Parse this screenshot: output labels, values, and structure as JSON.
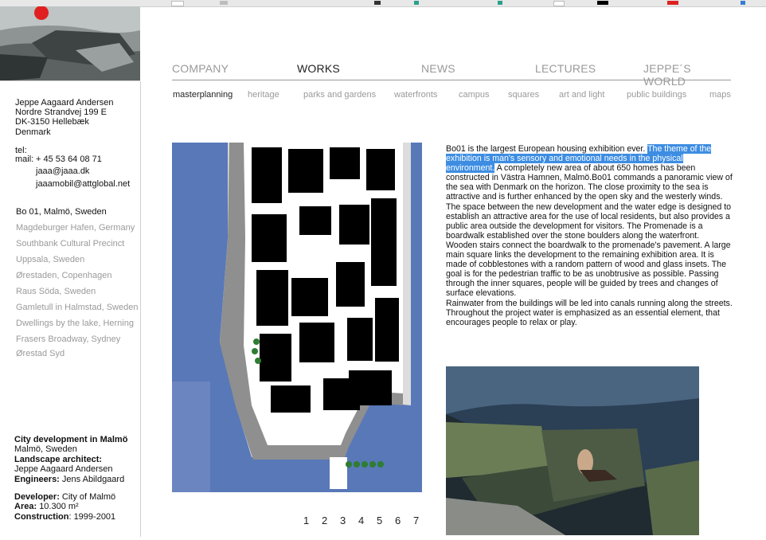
{
  "nav": {
    "main": [
      {
        "label": "COMPANY",
        "active": false
      },
      {
        "label": "WORKS",
        "active": true
      },
      {
        "label": "NEWS",
        "active": false
      },
      {
        "label": "LECTURES",
        "active": false
      },
      {
        "label": "JEPPE´S WORLD",
        "active": false
      }
    ],
    "sub": [
      {
        "label": "masterplanning",
        "active": true
      },
      {
        "label": "heritage",
        "active": false
      },
      {
        "label": "parks and gardens",
        "active": false
      },
      {
        "label": "waterfronts",
        "active": false
      },
      {
        "label": "campus",
        "active": false
      },
      {
        "label": "squares",
        "active": false
      },
      {
        "label": "art and light",
        "active": false
      },
      {
        "label": "public buildings",
        "active": false
      },
      {
        "label": "maps",
        "active": false
      }
    ]
  },
  "contact": {
    "name": "Jeppe Aagaard Andersen",
    "street": "Nordre Strandvej 199 E",
    "city": "DK-3150 Hellebæk",
    "country": "Denmark",
    "tel_label": "tel:",
    "mail_label": "mail:",
    "tel": "+ 45 53 64 08 71",
    "email1": "jaaa@jaaa.dk",
    "email2": "jaaamobil@attglobal.net"
  },
  "projects": [
    {
      "label": "Bo 01, Malmö, Sweden",
      "active": true
    },
    {
      "label": "Magdeburger Hafen, Germany",
      "active": false
    },
    {
      "label": "Southbank Cultural Precinct",
      "active": false
    },
    {
      "label": "Uppsala, Sweden",
      "active": false
    },
    {
      "label": "Ørestaden, Copenhagen",
      "active": false
    },
    {
      "label": "Raus Söda, Sweden",
      "active": false
    },
    {
      "label": "Gamletull in Halmstad, Sweden",
      "active": false
    },
    {
      "label": "Dwellings by the lake, Herning",
      "active": false
    },
    {
      "label": "Frasers Broadway, Sydney",
      "active": false
    },
    {
      "label": "Ørestad Syd",
      "active": false
    }
  ],
  "credits": {
    "title": "City development in Malmö",
    "location": "Malmö, Sweden",
    "architect_label": "Landscape architect:",
    "architect": "Jeppe Aagaard Andersen",
    "engineers_label": "Engineers:",
    "engineers": "Jens Abildgaard",
    "developer_label": "Developer:",
    "developer": "City of Malmö",
    "area_label": "Area:",
    "area": "10.300 m²",
    "construction_label": "Construction",
    "construction": ": 1999-2001"
  },
  "pager": [
    "1",
    "2",
    "3",
    "4",
    "5",
    "6",
    "7"
  ],
  "description": {
    "intro": "Bo01 is the largest European housing exhibition ever.",
    "highlight": "The theme of the exhibition is man's sensory and emotional needs in the physical environment.",
    "body": "A completely new area of about 650 homes has been constructed in Västra Hamnen, Malmö.Bo01 commands a panoramic view of the sea with Denmark on the horizon. The close proximity to the sea is attractive and is further enhanced by the open sky and the westerly winds. The space between the new development and the water edge is designed to establish an attractive area for the use of local residents, but also provides a public area outside the development for visitors. The Promenade is a boardwalk  established over the stone boulders along the waterfront. Wooden stairs connect the boardwalk to the promenade's pavement. A large main square links the development to the remaining exhibition area. It is made of cobblestones with a random pattern of wood and glass insets. The goal is for the pedestrian traffic to be as unobtrusive as possible. Passing through the inner squares, people will be guided by trees and changes of surface elevations.",
    "body2": "Rainwater from the buildings will be led into canals running along the streets. Throughout the project water is emphasized as an essential element,  that encourages  people to relax or play."
  },
  "colors": {
    "selection": "#3d8de2",
    "inactive_link": "#9a9a9a",
    "water": "#5878b8"
  }
}
